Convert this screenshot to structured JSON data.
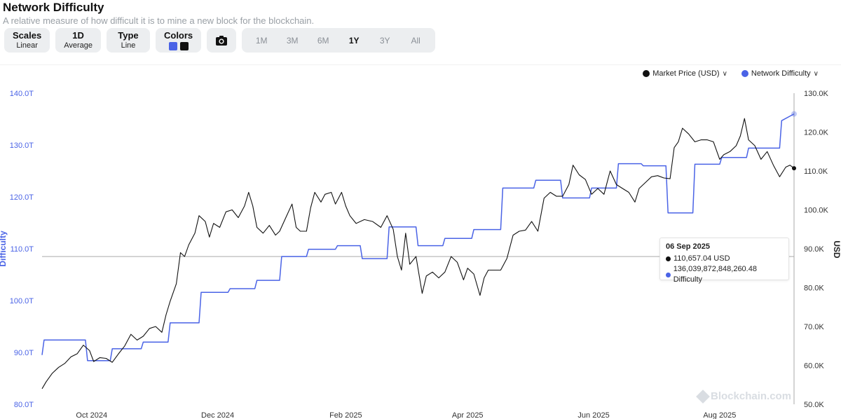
{
  "header": {
    "title": "Network Difficulty",
    "subtitle": "A relative measure of how difficult it is to mine a new block for the blockchain."
  },
  "controls": {
    "scales": {
      "label": "Scales",
      "value": "Linear"
    },
    "period": {
      "label": "1D",
      "value": "Average"
    },
    "type": {
      "label": "Type",
      "value": "Line"
    },
    "colors": {
      "label": "Colors",
      "swatch1": "#4a63e6",
      "swatch2": "#111111"
    },
    "camera_icon": "camera-icon",
    "ranges": [
      "1M",
      "3M",
      "6M",
      "1Y",
      "3Y",
      "All"
    ],
    "active_range": "1Y"
  },
  "legend": {
    "market_price": "Market Price (USD)",
    "network_difficulty": "Network Difficulty"
  },
  "tooltip": {
    "date": "06 Sep 2025",
    "price": "110,657.04 USD",
    "difficulty": "136,039,872,848,260.48 Difficulty"
  },
  "watermark": "Blockchain.com",
  "chart_data": {
    "type": "line",
    "x_ticks": [
      "Oct 2024",
      "Dec 2024",
      "Feb 2025",
      "Apr 2025",
      "Jun 2025",
      "Aug 2025"
    ],
    "left_axis": {
      "label": "Difficulty",
      "ticks": [
        "80.0T",
        "90.0T",
        "100.0T",
        "110.0T",
        "120.0T",
        "130.0T",
        "140.0T"
      ],
      "ylim": [
        80,
        140
      ],
      "color": "#4a63e6"
    },
    "right_axis": {
      "label": "USD",
      "ticks": [
        "50.0K",
        "60.0K",
        "70.0K",
        "80.0K",
        "90.0K",
        "100.0K",
        "110.0K",
        "120.0K",
        "130.0K"
      ],
      "ylim": [
        50,
        130
      ]
    },
    "x_range": [
      "2024-09-07",
      "2025-09-06"
    ],
    "crosshair_date": "2025-09-06",
    "series": [
      {
        "name": "Network Difficulty",
        "unit": "T",
        "color": "#4a63e6",
        "points": [
          [
            "2024-09-07",
            89.5
          ],
          [
            "2024-09-08",
            92.4
          ],
          [
            "2024-09-28",
            92.4
          ],
          [
            "2024-09-29",
            88.4
          ],
          [
            "2024-10-10",
            88.4
          ],
          [
            "2024-10-11",
            90.7
          ],
          [
            "2024-10-25",
            90.7
          ],
          [
            "2024-10-26",
            92.0
          ],
          [
            "2024-11-07",
            92.0
          ],
          [
            "2024-11-08",
            95.7
          ],
          [
            "2024-11-22",
            95.7
          ],
          [
            "2024-11-23",
            101.6
          ],
          [
            "2024-12-06",
            101.6
          ],
          [
            "2024-12-07",
            102.3
          ],
          [
            "2024-12-19",
            102.3
          ],
          [
            "2024-12-20",
            103.9
          ],
          [
            "2024-12-31",
            103.9
          ],
          [
            "2025-01-01",
            108.5
          ],
          [
            "2025-01-13",
            108.5
          ],
          [
            "2025-01-14",
            109.9
          ],
          [
            "2025-01-27",
            109.9
          ],
          [
            "2025-01-28",
            110.6
          ],
          [
            "2025-02-08",
            110.6
          ],
          [
            "2025-02-09",
            108.1
          ],
          [
            "2025-02-21",
            108.1
          ],
          [
            "2025-02-22",
            114.2
          ],
          [
            "2025-03-07",
            114.2
          ],
          [
            "2025-03-08",
            110.6
          ],
          [
            "2025-03-20",
            110.6
          ],
          [
            "2025-03-21",
            112.0
          ],
          [
            "2025-04-03",
            112.0
          ],
          [
            "2025-04-04",
            113.7
          ],
          [
            "2025-04-17",
            113.7
          ],
          [
            "2025-04-18",
            121.7
          ],
          [
            "2025-05-03",
            121.7
          ],
          [
            "2025-05-04",
            123.2
          ],
          [
            "2025-05-16",
            123.2
          ],
          [
            "2025-05-17",
            119.8
          ],
          [
            "2025-05-30",
            119.8
          ],
          [
            "2025-05-31",
            121.7
          ],
          [
            "2025-06-12",
            121.7
          ],
          [
            "2025-06-13",
            126.4
          ],
          [
            "2025-06-24",
            126.4
          ],
          [
            "2025-06-25",
            126.0
          ],
          [
            "2025-07-06",
            126.0
          ],
          [
            "2025-07-07",
            116.9
          ],
          [
            "2025-07-19",
            116.9
          ],
          [
            "2025-07-20",
            126.3
          ],
          [
            "2025-08-01",
            126.3
          ],
          [
            "2025-08-02",
            127.6
          ],
          [
            "2025-08-14",
            127.6
          ],
          [
            "2025-08-15",
            129.4
          ],
          [
            "2025-08-30",
            129.4
          ],
          [
            "2025-08-31",
            134.7
          ],
          [
            "2025-09-06",
            136.0
          ]
        ]
      },
      {
        "name": "Market Price (USD)",
        "unit": "USD",
        "color": "#111111",
        "points": [
          [
            "2024-09-07",
            54.0
          ],
          [
            "2024-09-09",
            55.8
          ],
          [
            "2024-09-12",
            58.0
          ],
          [
            "2024-09-15",
            59.5
          ],
          [
            "2024-09-18",
            60.5
          ],
          [
            "2024-09-21",
            62.2
          ],
          [
            "2024-09-24",
            63.0
          ],
          [
            "2024-09-27",
            65.2
          ],
          [
            "2024-09-30",
            63.8
          ],
          [
            "2024-10-02",
            61.0
          ],
          [
            "2024-10-05",
            62.0
          ],
          [
            "2024-10-08",
            61.8
          ],
          [
            "2024-10-11",
            60.8
          ],
          [
            "2024-10-14",
            63.0
          ],
          [
            "2024-10-17",
            65.0
          ],
          [
            "2024-10-20",
            68.0
          ],
          [
            "2024-10-23",
            66.5
          ],
          [
            "2024-10-26",
            67.5
          ],
          [
            "2024-10-29",
            69.5
          ],
          [
            "2024-11-01",
            70.0
          ],
          [
            "2024-11-04",
            68.5
          ],
          [
            "2024-11-06",
            73.0
          ],
          [
            "2024-11-08",
            76.5
          ],
          [
            "2024-11-11",
            81.0
          ],
          [
            "2024-11-13",
            89.0
          ],
          [
            "2024-11-15",
            88.0
          ],
          [
            "2024-11-17",
            91.0
          ],
          [
            "2024-11-20",
            94.0
          ],
          [
            "2024-11-22",
            98.5
          ],
          [
            "2024-11-25",
            97.0
          ],
          [
            "2024-11-27",
            93.0
          ],
          [
            "2024-11-29",
            96.5
          ],
          [
            "2024-12-02",
            95.5
          ],
          [
            "2024-12-05",
            99.5
          ],
          [
            "2024-12-08",
            100.0
          ],
          [
            "2024-12-11",
            98.0
          ],
          [
            "2024-12-14",
            101.0
          ],
          [
            "2024-12-16",
            104.5
          ],
          [
            "2024-12-18",
            101.0
          ],
          [
            "2024-12-20",
            95.5
          ],
          [
            "2024-12-23",
            94.0
          ],
          [
            "2024-12-26",
            96.0
          ],
          [
            "2024-12-29",
            93.5
          ],
          [
            "2024-12-31",
            94.5
          ],
          [
            "2025-01-03",
            98.0
          ],
          [
            "2025-01-06",
            101.5
          ],
          [
            "2025-01-08",
            95.5
          ],
          [
            "2025-01-10",
            94.5
          ],
          [
            "2025-01-13",
            94.5
          ],
          [
            "2025-01-15",
            100.5
          ],
          [
            "2025-01-17",
            104.5
          ],
          [
            "2025-01-20",
            102.0
          ],
          [
            "2025-01-22",
            104.0
          ],
          [
            "2025-01-25",
            104.5
          ],
          [
            "2025-01-27",
            101.5
          ],
          [
            "2025-01-30",
            104.5
          ],
          [
            "2025-02-01",
            101.0
          ],
          [
            "2025-02-03",
            98.5
          ],
          [
            "2025-02-06",
            96.5
          ],
          [
            "2025-02-10",
            97.5
          ],
          [
            "2025-02-14",
            97.0
          ],
          [
            "2025-02-18",
            95.5
          ],
          [
            "2025-02-21",
            98.5
          ],
          [
            "2025-02-24",
            95.0
          ],
          [
            "2025-02-26",
            88.0
          ],
          [
            "2025-02-28",
            84.5
          ],
          [
            "2025-03-02",
            94.0
          ],
          [
            "2025-03-04",
            86.0
          ],
          [
            "2025-03-07",
            88.0
          ],
          [
            "2025-03-10",
            78.5
          ],
          [
            "2025-03-12",
            83.0
          ],
          [
            "2025-03-15",
            84.0
          ],
          [
            "2025-03-18",
            82.5
          ],
          [
            "2025-03-21",
            84.0
          ],
          [
            "2025-03-24",
            88.0
          ],
          [
            "2025-03-27",
            86.5
          ],
          [
            "2025-03-30",
            82.0
          ],
          [
            "2025-04-01",
            85.0
          ],
          [
            "2025-04-04",
            83.5
          ],
          [
            "2025-04-07",
            78.0
          ],
          [
            "2025-04-09",
            82.5
          ],
          [
            "2025-04-11",
            84.5
          ],
          [
            "2025-04-14",
            84.5
          ],
          [
            "2025-04-17",
            84.5
          ],
          [
            "2025-04-20",
            87.5
          ],
          [
            "2025-04-23",
            93.5
          ],
          [
            "2025-04-26",
            94.5
          ],
          [
            "2025-04-29",
            94.8
          ],
          [
            "2025-05-02",
            97.0
          ],
          [
            "2025-05-05",
            94.5
          ],
          [
            "2025-05-08",
            103.0
          ],
          [
            "2025-05-11",
            104.5
          ],
          [
            "2025-05-14",
            103.5
          ],
          [
            "2025-05-17",
            103.5
          ],
          [
            "2025-05-20",
            106.5
          ],
          [
            "2025-05-22",
            111.5
          ],
          [
            "2025-05-25",
            109.0
          ],
          [
            "2025-05-28",
            107.8
          ],
          [
            "2025-05-31",
            104.0
          ],
          [
            "2025-06-03",
            105.5
          ],
          [
            "2025-06-06",
            104.0
          ],
          [
            "2025-06-09",
            110.0
          ],
          [
            "2025-06-12",
            106.5
          ],
          [
            "2025-06-15",
            105.5
          ],
          [
            "2025-06-18",
            104.5
          ],
          [
            "2025-06-21",
            102.0
          ],
          [
            "2025-06-23",
            105.5
          ],
          [
            "2025-06-26",
            107.0
          ],
          [
            "2025-06-29",
            108.5
          ],
          [
            "2025-07-02",
            108.8
          ],
          [
            "2025-07-05",
            108.2
          ],
          [
            "2025-07-08",
            108.0
          ],
          [
            "2025-07-10",
            116.0
          ],
          [
            "2025-07-12",
            117.5
          ],
          [
            "2025-07-14",
            121.0
          ],
          [
            "2025-07-17",
            119.5
          ],
          [
            "2025-07-20",
            117.5
          ],
          [
            "2025-07-23",
            118.0
          ],
          [
            "2025-07-26",
            118.0
          ],
          [
            "2025-07-29",
            117.5
          ],
          [
            "2025-08-01",
            113.0
          ],
          [
            "2025-08-03",
            114.2
          ],
          [
            "2025-08-06",
            115.0
          ],
          [
            "2025-08-09",
            116.5
          ],
          [
            "2025-08-11",
            119.0
          ],
          [
            "2025-08-13",
            123.5
          ],
          [
            "2025-08-15",
            118.0
          ],
          [
            "2025-08-18",
            116.5
          ],
          [
            "2025-08-21",
            113.0
          ],
          [
            "2025-08-24",
            115.0
          ],
          [
            "2025-08-27",
            111.5
          ],
          [
            "2025-08-30",
            108.5
          ],
          [
            "2025-09-02",
            111.0
          ],
          [
            "2025-09-04",
            111.5
          ],
          [
            "2025-09-06",
            110.7
          ]
        ]
      }
    ]
  }
}
